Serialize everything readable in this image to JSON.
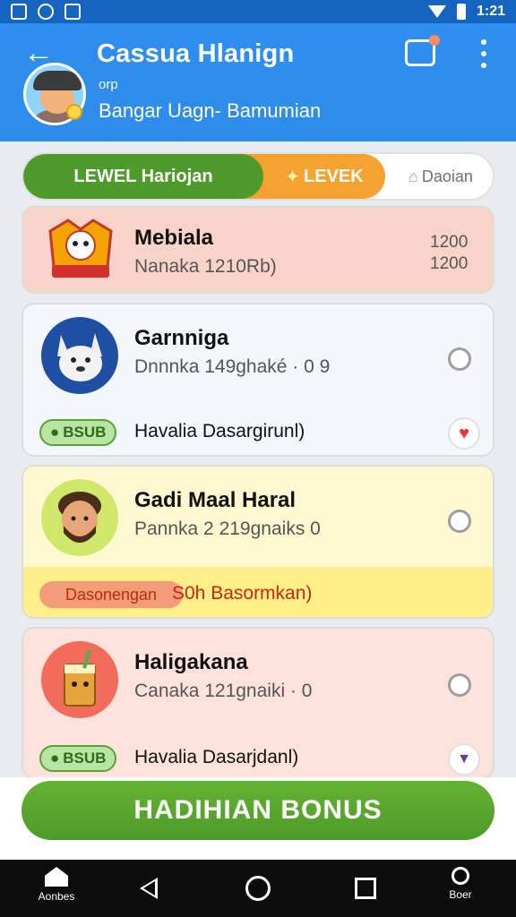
{
  "status_bar": {
    "time": "1:21"
  },
  "header": {
    "title": "Cassua Hlanign",
    "subtitle_small": "orp",
    "subtitle": "Bangar Uagn- Bamumian"
  },
  "tabs": [
    {
      "label": "LEWEL Hariojan"
    },
    {
      "label": "LEVEK"
    },
    {
      "label": "Daoian"
    }
  ],
  "cards": [
    {
      "title": "Mebiala",
      "subtitle": "Nanaka 1210Rb)",
      "num_top": "1200",
      "num_bottom": "1200"
    },
    {
      "title": "Garnniga",
      "subtitle": "Dnnnka 149ghaké · 0   9",
      "pill": "BSUB",
      "footer": "Havalia Dasargirunl)"
    },
    {
      "title": "Gadi Maal Haral",
      "subtitle": "Pannka 2 219gnaiks   0",
      "pill": "Dasonengan",
      "footer": "S0h Basormkan)"
    },
    {
      "title": "Haligakana",
      "subtitle": "Canaka 121gnaiki · 0",
      "pill": "BSUB",
      "footer": "Havalia Dasarjdanl)"
    }
  ],
  "bonus_button": {
    "label": "HADIHIAN BONUS"
  },
  "navbar": {
    "home_label": "Aonbes",
    "user_label": "Boer"
  },
  "colors": {
    "primary": "#2f8ff0",
    "green": "#4e9a2a",
    "orange": "#f5a230"
  }
}
